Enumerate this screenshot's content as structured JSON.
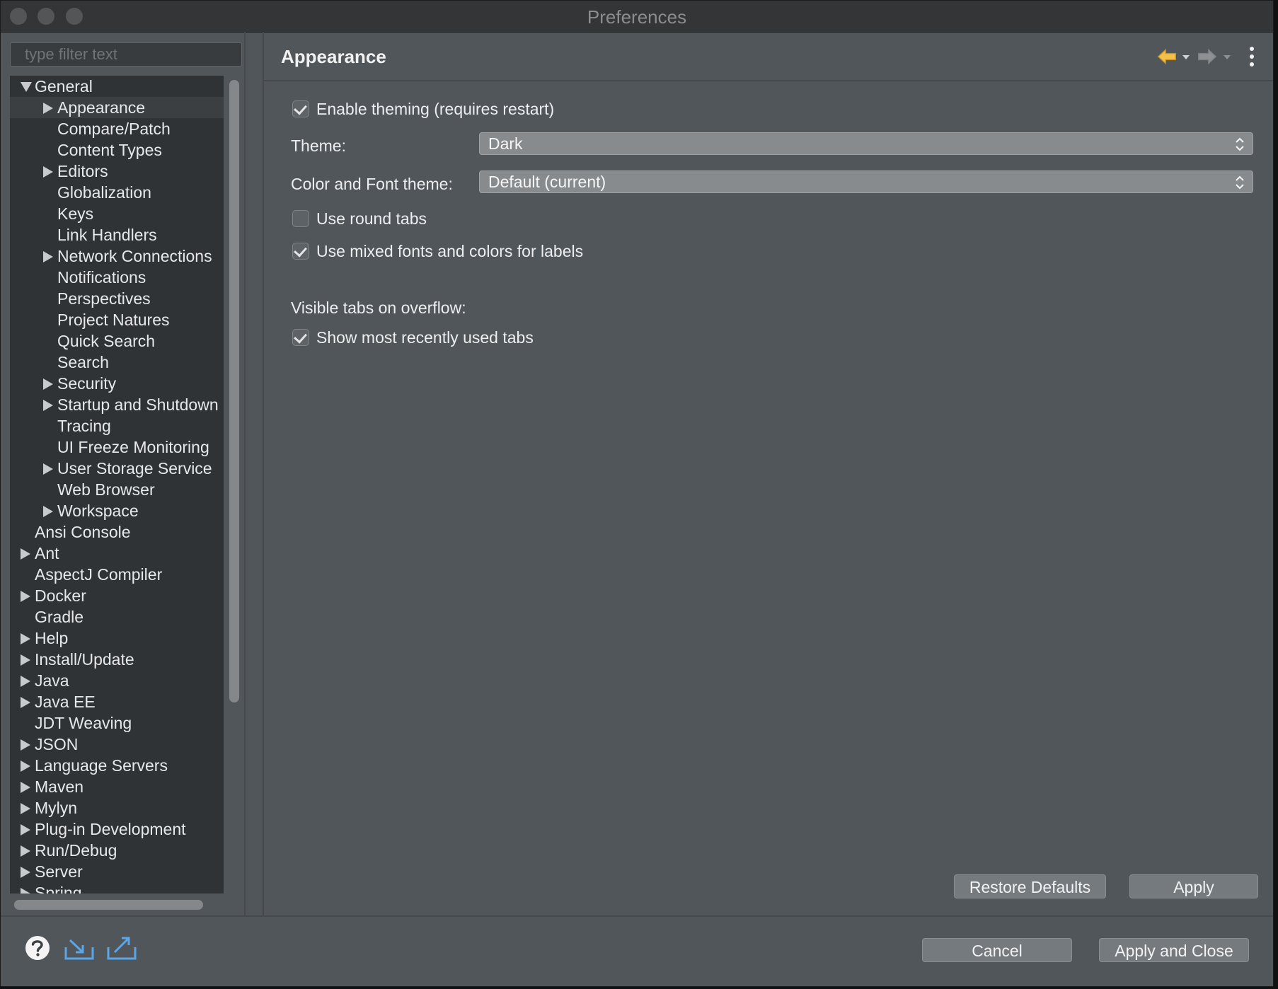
{
  "window": {
    "title": "Preferences"
  },
  "sidebar": {
    "filter_placeholder": "type filter text",
    "items": [
      {
        "label": "General",
        "level": 0,
        "expanded": true,
        "expandable": true
      },
      {
        "label": "Appearance",
        "level": 1,
        "expandable": true,
        "selected": true
      },
      {
        "label": "Compare/Patch",
        "level": 1,
        "expandable": false
      },
      {
        "label": "Content Types",
        "level": 1,
        "expandable": false
      },
      {
        "label": "Editors",
        "level": 1,
        "expandable": true
      },
      {
        "label": "Globalization",
        "level": 1,
        "expandable": false
      },
      {
        "label": "Keys",
        "level": 1,
        "expandable": false
      },
      {
        "label": "Link Handlers",
        "level": 1,
        "expandable": false
      },
      {
        "label": "Network Connections",
        "level": 1,
        "expandable": true
      },
      {
        "label": "Notifications",
        "level": 1,
        "expandable": false
      },
      {
        "label": "Perspectives",
        "level": 1,
        "expandable": false
      },
      {
        "label": "Project Natures",
        "level": 1,
        "expandable": false
      },
      {
        "label": "Quick Search",
        "level": 1,
        "expandable": false
      },
      {
        "label": "Search",
        "level": 1,
        "expandable": false
      },
      {
        "label": "Security",
        "level": 1,
        "expandable": true
      },
      {
        "label": "Startup and Shutdown",
        "level": 1,
        "expandable": true
      },
      {
        "label": "Tracing",
        "level": 1,
        "expandable": false
      },
      {
        "label": "UI Freeze Monitoring",
        "level": 1,
        "expandable": false
      },
      {
        "label": "User Storage Service",
        "level": 1,
        "expandable": true
      },
      {
        "label": "Web Browser",
        "level": 1,
        "expandable": false
      },
      {
        "label": "Workspace",
        "level": 1,
        "expandable": true
      },
      {
        "label": "Ansi Console",
        "level": 0,
        "expandable": false
      },
      {
        "label": "Ant",
        "level": 0,
        "expandable": true
      },
      {
        "label": "AspectJ Compiler",
        "level": 0,
        "expandable": false
      },
      {
        "label": "Docker",
        "level": 0,
        "expandable": true
      },
      {
        "label": "Gradle",
        "level": 0,
        "expandable": false
      },
      {
        "label": "Help",
        "level": 0,
        "expandable": true
      },
      {
        "label": "Install/Update",
        "level": 0,
        "expandable": true
      },
      {
        "label": "Java",
        "level": 0,
        "expandable": true
      },
      {
        "label": "Java EE",
        "level": 0,
        "expandable": true
      },
      {
        "label": "JDT Weaving",
        "level": 0,
        "expandable": false
      },
      {
        "label": "JSON",
        "level": 0,
        "expandable": true
      },
      {
        "label": "Language Servers",
        "level": 0,
        "expandable": true
      },
      {
        "label": "Maven",
        "level": 0,
        "expandable": true
      },
      {
        "label": "Mylyn",
        "level": 0,
        "expandable": true
      },
      {
        "label": "Plug-in Development",
        "level": 0,
        "expandable": true
      },
      {
        "label": "Run/Debug",
        "level": 0,
        "expandable": true
      },
      {
        "label": "Server",
        "level": 0,
        "expandable": true
      },
      {
        "label": "Spring",
        "level": 0,
        "expandable": true
      }
    ]
  },
  "content": {
    "title": "Appearance",
    "enable_theming": {
      "label": "Enable theming (requires restart)",
      "checked": true
    },
    "theme": {
      "label": "Theme:",
      "value": "Dark"
    },
    "color_font_theme": {
      "label": "Color and Font theme:",
      "value": "Default (current)"
    },
    "round_tabs": {
      "label": "Use round tabs",
      "checked": false
    },
    "mixed_fonts": {
      "label": "Use mixed fonts and colors for labels",
      "checked": true
    },
    "visible_tabs_label": "Visible tabs on overflow:",
    "show_recent_tabs": {
      "label": "Show most recently used tabs",
      "checked": true
    },
    "restore_defaults_label": "Restore Defaults",
    "apply_label": "Apply"
  },
  "footer": {
    "cancel_label": "Cancel",
    "apply_close_label": "Apply and Close",
    "icons": [
      "help-icon",
      "import-icon",
      "export-icon"
    ]
  },
  "colors": {
    "background": "#50565a",
    "tree_background": "#303336",
    "back_arrow": "#f3c04c",
    "forward_arrow": "#8d9194"
  }
}
